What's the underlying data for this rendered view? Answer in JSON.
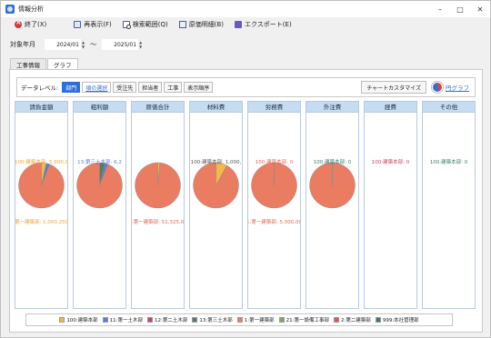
{
  "window": {
    "title": "情報分析",
    "controls": [
      "minimize-icon",
      "maximize-icon",
      "close-icon"
    ]
  },
  "toolbar": {
    "exit_label": "終了(X)",
    "redisplay_label": "再表示(F)",
    "search_range_label": "検索範囲(Q)",
    "detail_label": "原価明細(B)",
    "export_label": "エクスポート(E)"
  },
  "period": {
    "label": "対象年月",
    "from": "2024/01",
    "to": "2025/01",
    "separator": "～"
  },
  "tabs": [
    {
      "label": "工事情報",
      "active": false
    },
    {
      "label": "グラフ",
      "active": true
    }
  ],
  "filter": {
    "label": "データレベル:",
    "levels": [
      {
        "label": "部門",
        "selected": true
      },
      {
        "label": "頃の選択",
        "link": true
      },
      {
        "label": "受注先"
      },
      {
        "label": "担当者"
      },
      {
        "label": "工事"
      },
      {
        "label": "表示順序"
      }
    ],
    "customize_label": "チャートカスタマイズ",
    "pie_link_label": "円グラフ"
  },
  "colors": {
    "accent": "#2f6fd6",
    "header_bg": "#c5dcf3",
    "dept_colors": [
      "#f2b94a",
      "#5a7fcf",
      "#c0465e",
      "#5b7a6b",
      "#ea7c62",
      "#7eab5f",
      "#e2544e",
      "#3c7b68"
    ]
  },
  "chart_data": [
    {
      "type": "pie",
      "title": "請負金額",
      "slices": [
        {
          "name": "100:建築本部",
          "value": 3.5
        },
        {
          "name": "11:第一土木部",
          "value": 2.5
        },
        {
          "name": "1:第一建築部",
          "value": 94
        }
      ],
      "labels": [
        {
          "text": "100:建築本部: 5,900,0",
          "color": "#f0a537",
          "pos": "top"
        },
        {
          "text": "1:第一建築部: 1,000,250,0",
          "color": "#f0a537",
          "pos": "bottom"
        }
      ]
    },
    {
      "type": "pie",
      "title": "粗利額",
      "slices": [
        {
          "name": "13:第三土木部",
          "value": 4
        },
        {
          "name": "11:第一土木部",
          "value": 2
        },
        {
          "name": "1:第一建築部",
          "value": 94
        }
      ],
      "labels": [
        {
          "text": "13:第三土木部: 6,2",
          "color": "#5a7fcf",
          "pos": "top"
        }
      ]
    },
    {
      "type": "pie",
      "title": "原価合計",
      "slices": [
        {
          "name": "100:建築本部",
          "value": 1.5
        },
        {
          "name": "1:第一建築部",
          "value": 98.5
        }
      ],
      "labels": [
        {
          "text": "1:第一建築部: 51,325,00",
          "color": "#e06b55",
          "pos": "bottom"
        }
      ]
    },
    {
      "type": "pie",
      "title": "材料費",
      "slices": [
        {
          "name": "100:建築本部",
          "value": 8
        },
        {
          "name": "1:第一建築部",
          "value": 92
        }
      ],
      "labels": [
        {
          "text": "100:建築本部: 1,000,",
          "color": "#555555",
          "pos": "top"
        }
      ]
    },
    {
      "type": "pie",
      "title": "労務費",
      "slices": [
        {
          "name": "100:建築本部",
          "value": 0.3
        },
        {
          "name": "1:第一建築部",
          "value": 99.7
        }
      ],
      "labels": [
        {
          "text": "100:建築本部: 0",
          "color": "#e06b55",
          "pos": "top"
        },
        {
          "text": "1:第一建築部: 5,000,00",
          "color": "#e06b55",
          "pos": "bottom"
        }
      ]
    },
    {
      "type": "pie",
      "title": "外注費",
      "slices": [
        {
          "name": "100:建築本部",
          "value": 0.3
        },
        {
          "name": "1:第一建築部",
          "value": 99.7
        }
      ],
      "labels": [
        {
          "text": "100:建築本部: 0",
          "color": "#3c7b68",
          "pos": "top"
        }
      ]
    },
    {
      "type": "pie",
      "title": "経費",
      "slices": [],
      "labels": [
        {
          "text": "100:建築本部: 0",
          "color": "#c0465e",
          "pos": "top"
        }
      ]
    },
    {
      "type": "pie",
      "title": "その他",
      "slices": [],
      "labels": [
        {
          "text": "100:建築本部: 0",
          "color": "#3c7b68",
          "pos": "top"
        }
      ]
    }
  ],
  "legend": [
    {
      "label": "100:建築本部",
      "color": "#f2b94a"
    },
    {
      "label": "11:第一土木部",
      "color": "#5a7fcf"
    },
    {
      "label": "12:第二土木部",
      "color": "#c0465e"
    },
    {
      "label": "13:第三土木部",
      "color": "#5b7a6b"
    },
    {
      "label": "1:第一建築部",
      "color": "#ea7c62"
    },
    {
      "label": "21:第一設備工事部",
      "color": "#7eab5f"
    },
    {
      "label": "2:第二建築部",
      "color": "#e2544e"
    },
    {
      "label": "999:本社管理部",
      "color": "#3c7b68"
    }
  ]
}
